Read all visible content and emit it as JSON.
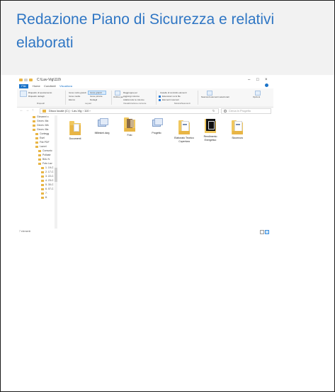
{
  "card": {
    "title": "Redazione Piano di Sicurezza e relativi elaborati"
  },
  "explorer": {
    "title_path": "C:\\Lav-Vig\\110\\",
    "window_controls": [
      "–",
      "□",
      "×"
    ],
    "tabs": [
      "File",
      "Home",
      "Condividi",
      "Visualizza"
    ],
    "ribbon": {
      "items": [
        "Riquadro di spostamento",
        "Riquadro dettagli",
        "Icone molto grandi",
        "Icone grandi",
        "Icone medie",
        "Icone piccole",
        "Elenco",
        "Dettagli",
        "Ordina per",
        "Raggruppa per",
        "Aggiungi colonne",
        "Adatta tutte le colonne",
        "Caselle di controllo elementi",
        "Estensioni nomi file",
        "Elementi nascosti",
        "Nascondi elementi selezionati",
        "Opzioni"
      ],
      "groups": [
        "Riquadri",
        "Layout",
        "Visualizzazione corrente",
        "Mostra/Nascondi"
      ]
    },
    "address": {
      "nav": [
        "←",
        "→",
        "↑"
      ],
      "path": "Disco locale (C:) › Lav-Vig › 110 ›",
      "refresh": "↻",
      "search_placeholder": "Cerca in Progetto"
    },
    "tree": [
      "Giovanni c.",
      "Geom. Ma",
      "Geom. MA",
      "Geom. Ma",
      "Contegg",
      "Esel",
      "File PDF",
      "Lavori",
      "Comunic",
      "Pollastr",
      "BAL N",
      "Foto Lav",
      "1. 19-C",
      "2. 17-C",
      "3. 22-C",
      "4. 23-C",
      "5. 30-C",
      "6. 07-C",
      "7.",
      "8."
    ],
    "files": [
      {
        "name": "Documenti",
        "kind": "folder"
      },
      {
        "name": "Millesimi.dwg",
        "kind": "image"
      },
      {
        "name": "Foto",
        "kind": "photo"
      },
      {
        "name": "Progetto",
        "kind": "image"
      },
      {
        "name": "Elaborato Tecnico Copertura",
        "kind": "document"
      },
      {
        "name": "Rendimento Energetico",
        "kind": "dark"
      },
      {
        "name": "Sicurezza",
        "kind": "document"
      }
    ],
    "status": "7 elementi"
  },
  "colors": {
    "title": "#2f76c4",
    "header_bg": "#f2f2f2",
    "folder": "#e8b545",
    "accent": "#1a73c9"
  }
}
